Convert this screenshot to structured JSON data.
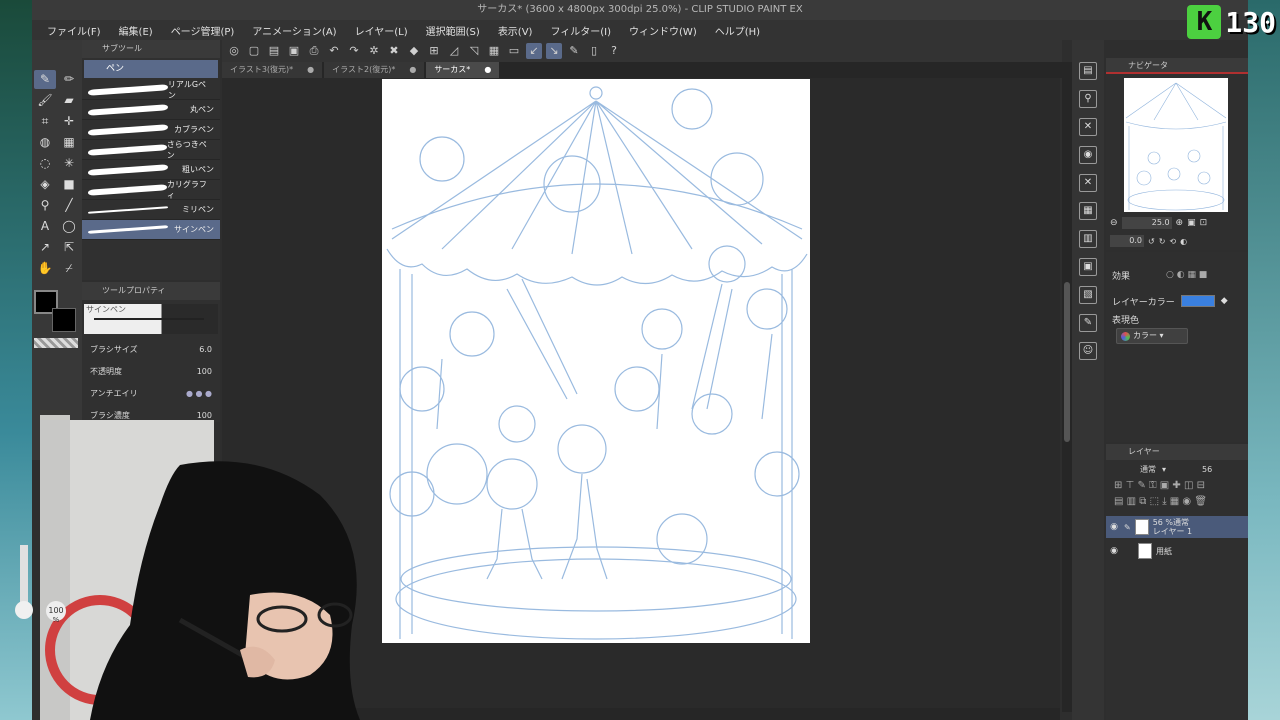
{
  "window": {
    "title": "サーカス* (3600 x 4800px 300dpi 25.0%)  - CLIP STUDIO PAINT EX"
  },
  "menu": [
    "ファイル(F)",
    "編集(E)",
    "ページ管理(P)",
    "アニメーション(A)",
    "レイヤー(L)",
    "選択範囲(S)",
    "表示(V)",
    "フィルター(I)",
    "ウィンドウ(W)",
    "ヘルプ(H)"
  ],
  "tabs": [
    {
      "label": "イラスト3(復元)*",
      "close": "●"
    },
    {
      "label": "イラスト2(復元)*",
      "close": "●"
    },
    {
      "label": "サーカス*",
      "close": "●"
    }
  ],
  "subtool": {
    "panel_title": "サブツール",
    "group": "ペン",
    "brushes": [
      "リアルGペン",
      "丸ペン",
      "カブラペン",
      "さらつきペン",
      "粗いペン",
      "カリグラフィ",
      "ミリペン",
      "サインペン"
    ]
  },
  "tool_property": {
    "panel_title": "ツールプロパティ",
    "preview_label": "サインペン",
    "brush_size_label": "ブラシサイズ",
    "brush_size_value": "6.0",
    "opacity_label": "不透明度",
    "opacity_value": "100",
    "antialias_label": "アンチエイリ",
    "density_label": "ブラシ濃度",
    "density_value": "100"
  },
  "navigator": {
    "title": "ナビゲータ",
    "zoom": "25.0",
    "rotation": "0.0"
  },
  "layer_property": {
    "effect_label": "効果",
    "layer_color_label": "レイヤーカラー",
    "layer_color": "#3a80e0",
    "expression_label": "表現色",
    "expression_value": "カラー"
  },
  "layers": {
    "title": "レイヤー",
    "blend_mode": "通常",
    "opacity": "56",
    "items": [
      {
        "line1": "56 %通常",
        "line2": "レイヤー 1",
        "selected": true
      },
      {
        "line1": "用紙",
        "line2": "",
        "selected": false
      }
    ]
  },
  "stream": {
    "badge_letter": "K",
    "badge_number": "130",
    "wheel_opacity": "100",
    "wheel_unit": "%"
  },
  "colors": {
    "accent": "#5a6a8a",
    "sketch": "#8fb3dc"
  }
}
